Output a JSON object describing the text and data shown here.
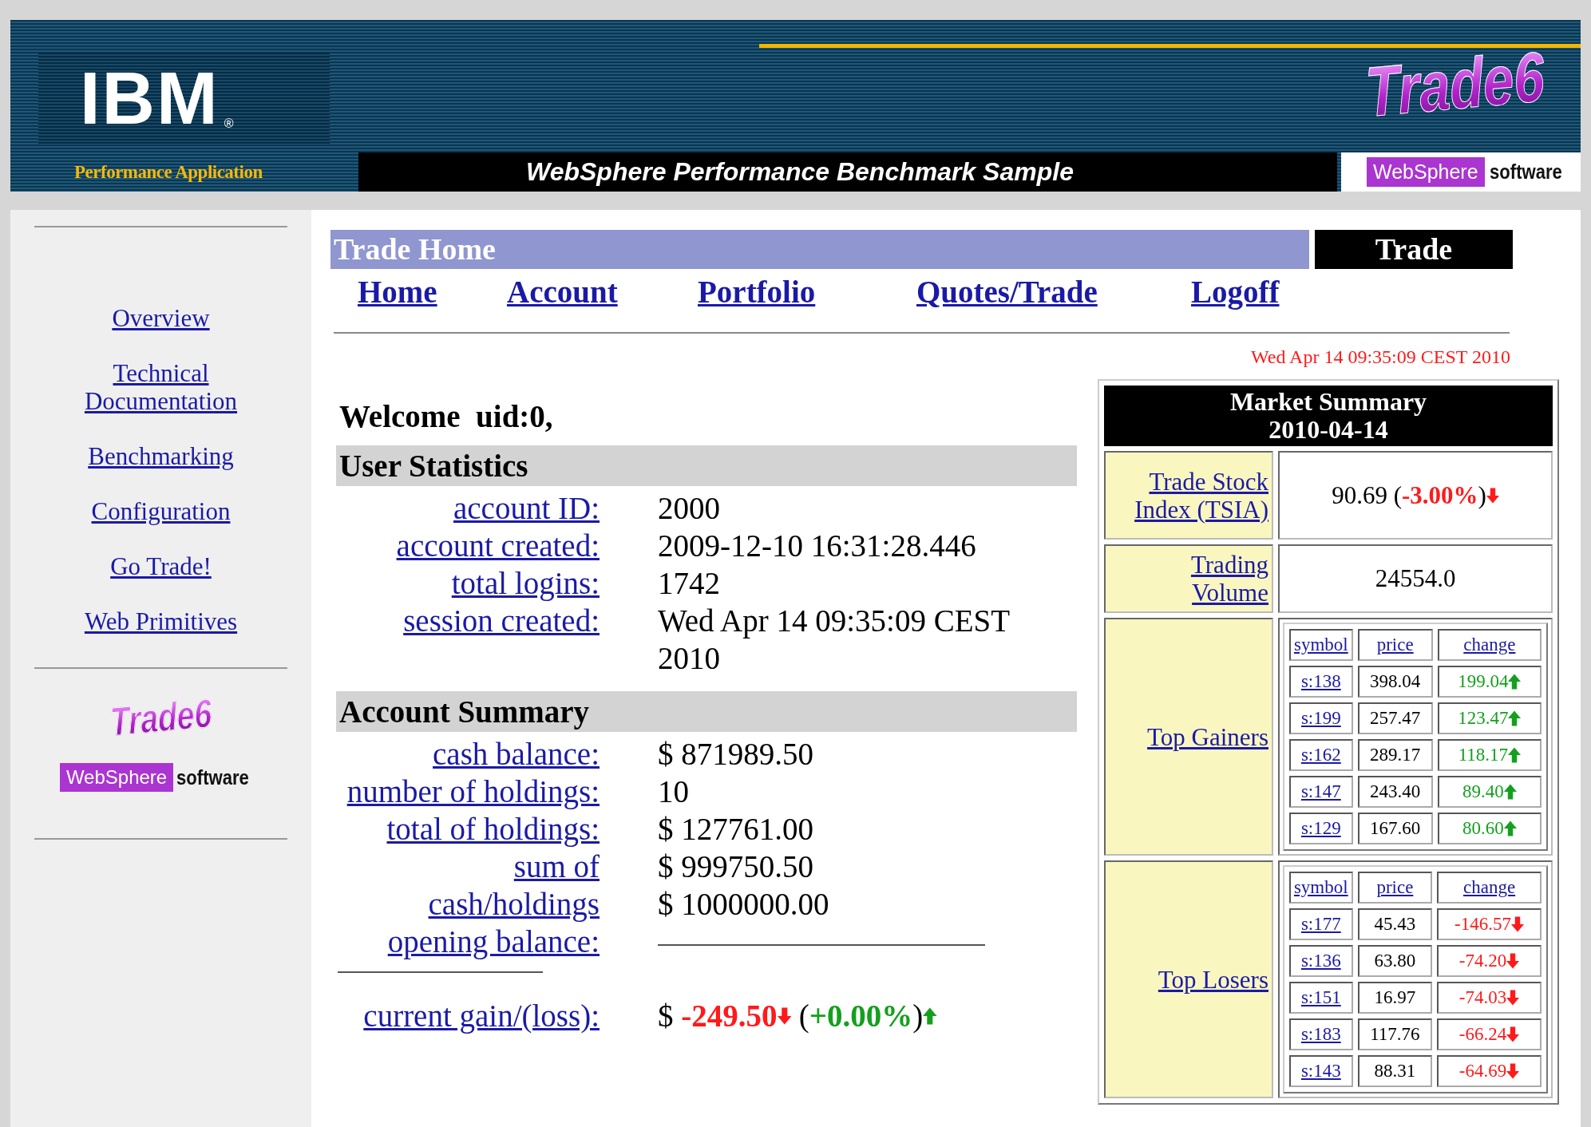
{
  "header": {
    "logo": "IBM",
    "logo_mark": "®",
    "subtitle": "Performance Application",
    "title": "WebSphere Performance Benchmark Sample",
    "product_logo": "Trade6",
    "brand": "WebSphere",
    "brand_suffix": "software"
  },
  "sidebar": {
    "items": [
      {
        "label": "Overview"
      },
      {
        "label": "Technical Documentation"
      },
      {
        "label": "Benchmarking"
      },
      {
        "label": "Configuration"
      },
      {
        "label": "Go Trade!"
      },
      {
        "label": "Web Primitives"
      }
    ],
    "logo": "Trade6",
    "brand": "WebSphere",
    "brand_suffix": "software"
  },
  "page_title": "Trade Home",
  "app_badge": "Trade",
  "nav": [
    {
      "label": "Home"
    },
    {
      "label": "Account"
    },
    {
      "label": "Portfolio"
    },
    {
      "label": "Quotes/Trade"
    },
    {
      "label": "Logoff"
    }
  ],
  "timestamp": "Wed Apr 14 09:35:09 CEST 2010",
  "welcome": "Welcome  uid:0,",
  "user_statistics": {
    "title": "User Statistics",
    "rows": [
      {
        "label": "account ID:",
        "value": "2000"
      },
      {
        "label": "account created:",
        "value": "2009-12-10 16:31:28.446"
      },
      {
        "label": "total logins:",
        "value": "1742"
      },
      {
        "label": "session created:",
        "value": "Wed Apr 14 09:35:09 CEST 2010"
      }
    ]
  },
  "account_summary": {
    "title": "Account Summary",
    "rows": [
      {
        "label": "cash balance:",
        "value": "$ 871989.50",
        "kind": "text"
      },
      {
        "label": "number of holdings:",
        "value": "10",
        "kind": "text"
      },
      {
        "label": "total of holdings:",
        "value": "$ 127761.00",
        "kind": "text"
      },
      {
        "label": "sum of",
        "value": "$ 999750.50",
        "kind": "text"
      },
      {
        "label": "cash/holdings",
        "value": "$ 1000000.00",
        "kind": "text"
      },
      {
        "label": "opening balance:",
        "kind": "rule"
      }
    ],
    "gain": {
      "label": "current gain/(loss):",
      "currency": "$",
      "amount": {
        "text": "-249.50",
        "kind": "down"
      },
      "open": "(",
      "percent": {
        "text": "+0.00%",
        "kind": "up"
      },
      "close": ")"
    }
  },
  "market_summary": {
    "title": "Market Summary",
    "date": "2010-04-14",
    "index": {
      "label": "Trade Stock Index (TSIA)",
      "value": "90.69",
      "open": "(",
      "change": {
        "text": "-3.00%",
        "kind": "down"
      },
      "close": ")"
    },
    "volume": {
      "label": "Trading Volume",
      "value": "24554.0"
    },
    "lists": [
      {
        "label": "Top Gainers",
        "columns": [
          "symbol",
          "price",
          "change"
        ],
        "rows": [
          {
            "symbol": "s:138",
            "price": "398.04",
            "change": "199.04",
            "kind": "up"
          },
          {
            "symbol": "s:199",
            "price": "257.47",
            "change": "123.47",
            "kind": "up"
          },
          {
            "symbol": "s:162",
            "price": "289.17",
            "change": "118.17",
            "kind": "up"
          },
          {
            "symbol": "s:147",
            "price": "243.40",
            "change": "89.40",
            "kind": "up"
          },
          {
            "symbol": "s:129",
            "price": "167.60",
            "change": "80.60",
            "kind": "up"
          }
        ]
      },
      {
        "label": "Top Losers",
        "columns": [
          "symbol",
          "price",
          "change"
        ],
        "rows": [
          {
            "symbol": "s:177",
            "price": "45.43",
            "change": "-146.57",
            "kind": "down"
          },
          {
            "symbol": "s:136",
            "price": "63.80",
            "change": "-74.20",
            "kind": "down"
          },
          {
            "symbol": "s:151",
            "price": "16.97",
            "change": "-74.03",
            "kind": "down"
          },
          {
            "symbol": "s:183",
            "price": "117.76",
            "change": "-66.24",
            "kind": "down"
          },
          {
            "symbol": "s:143",
            "price": "88.31",
            "change": "-64.69",
            "kind": "down"
          }
        ]
      }
    ]
  }
}
